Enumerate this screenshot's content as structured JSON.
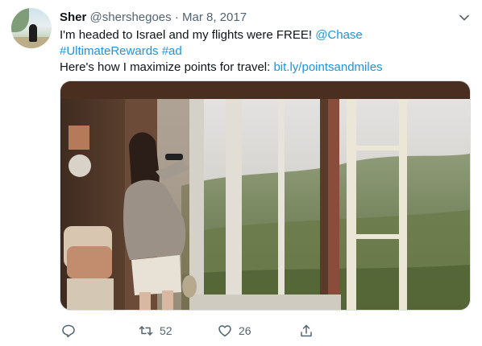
{
  "tweet": {
    "display_name": "Sher",
    "handle": "@shershegoes",
    "separator": "·",
    "date": "Mar 8, 2017",
    "text_line1_plain": "I'm headed to Israel and my flights were FREE!",
    "mention": "@Chase",
    "hashtag1": "#UltimateRewards",
    "hashtag2": "#ad",
    "text_line3_plain": "Here's how I maximize points for travel:",
    "link": "bit.ly/pointsandmiles"
  },
  "actions": {
    "retweet_count": "52",
    "like_count": "26"
  },
  "icons": {
    "menu": "chevron-down-icon",
    "reply": "reply-icon",
    "retweet": "retweet-icon",
    "like": "heart-icon",
    "share": "share-icon"
  },
  "colors": {
    "link": "#1b95e0",
    "meta": "#536471",
    "text": "#0f1419"
  }
}
